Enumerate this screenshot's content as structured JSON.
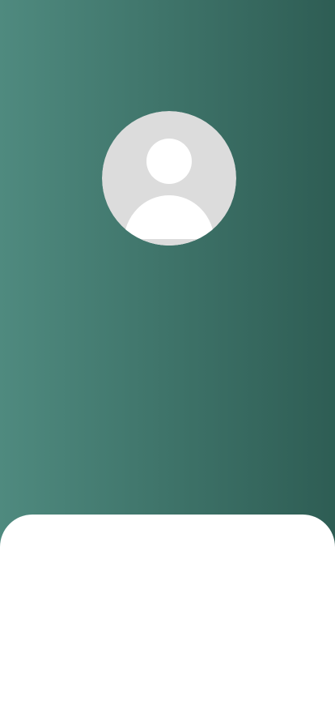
{
  "theme": {
    "gradient_start": "#4f8a7f",
    "gradient_end": "#2e5d54",
    "sheet_color": "#ffffff",
    "avatar_bg": "#dcdcdc",
    "avatar_figure": "#ffffff"
  },
  "profile": {
    "avatar_icon": "user-placeholder-icon"
  }
}
